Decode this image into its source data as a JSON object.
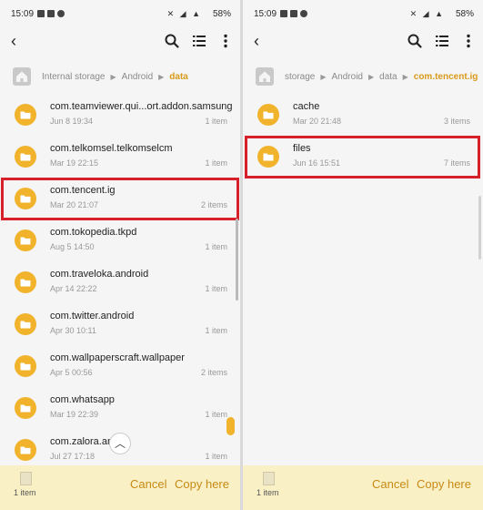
{
  "colors": {
    "folder": "#f1b32c",
    "accent": "#d99a1b",
    "highlight": "#d6202a",
    "bottom_bar": "#faf0c6"
  },
  "left": {
    "status": {
      "time": "15:09",
      "battery": "58%"
    },
    "breadcrumb": [
      "Internal storage",
      "Android",
      "data"
    ],
    "rows": [
      {
        "name": "com.teamviewer.qui...ort.addon.samsung",
        "date": "Jun 8 19:34",
        "count": "1 item"
      },
      {
        "name": "com.telkomsel.telkomselcm",
        "date": "Mar 19 22:15",
        "count": "1 item"
      },
      {
        "name": "com.tencent.ig",
        "date": "Mar 20 21:07",
        "count": "2 items"
      },
      {
        "name": "com.tokopedia.tkpd",
        "date": "Aug 5 14:50",
        "count": "1 item"
      },
      {
        "name": "com.traveloka.android",
        "date": "Apr 14 22:22",
        "count": "1 item"
      },
      {
        "name": "com.twitter.android",
        "date": "Apr 30 10:11",
        "count": "1 item"
      },
      {
        "name": "com.wallpaperscraft.wallpaper",
        "date": "Apr 5 00:56",
        "count": "2 items"
      },
      {
        "name": "com.whatsapp",
        "date": "Mar 19 22:39",
        "count": "1 item"
      },
      {
        "name": "com.zalora.and...",
        "date": "Jul 27 17:18",
        "count": "1 item"
      }
    ],
    "bottom": {
      "item_count": "1 item",
      "cancel": "Cancel",
      "copy": "Copy here"
    }
  },
  "right": {
    "status": {
      "time": "15:09",
      "battery": "58%"
    },
    "breadcrumb": [
      "storage",
      "Android",
      "data",
      "com.tencent.ig"
    ],
    "rows": [
      {
        "name": "cache",
        "date": "Mar 20 21:48",
        "count": "3 items"
      },
      {
        "name": "files",
        "date": "Jun 16 15:51",
        "count": "7 items"
      }
    ],
    "bottom": {
      "item_count": "1 item",
      "cancel": "Cancel",
      "copy": "Copy here"
    }
  }
}
